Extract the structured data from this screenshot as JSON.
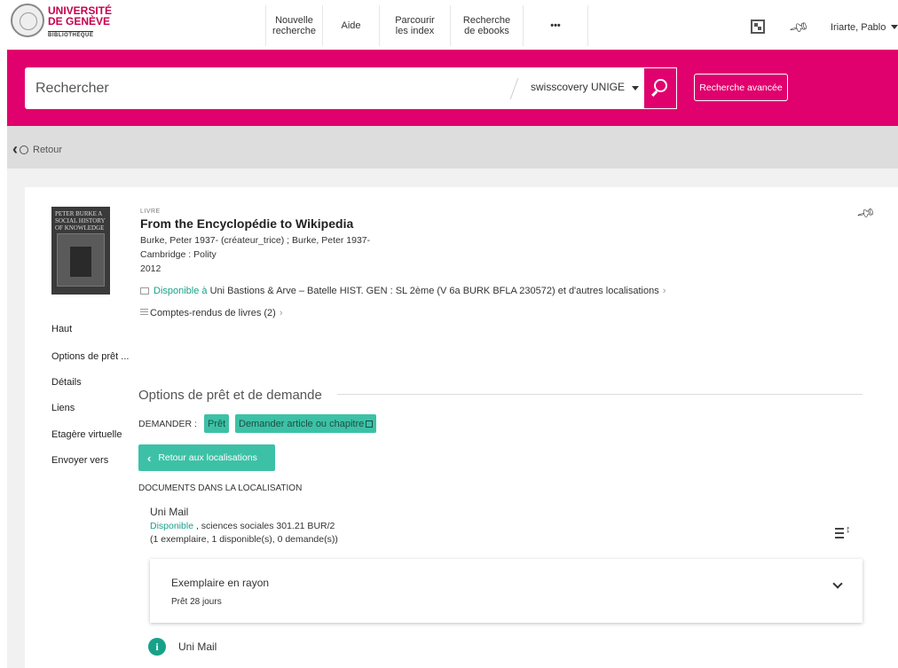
{
  "header": {
    "logo_line1": "UNIVERSITÉ",
    "logo_line2": "DE GENÈVE",
    "logo_sub": "BIBLIOTHÈQUE",
    "nav": [
      {
        "line1": "Nouvelle",
        "line2": "recherche"
      },
      {
        "line1": "Aide",
        "line2": ""
      },
      {
        "line1": "Parcourir",
        "line2": "les index"
      },
      {
        "line1": "Recherche",
        "line2": "de ebooks"
      },
      {
        "line1": "•••",
        "line2": ""
      }
    ],
    "user": "Iriarte, Pablo"
  },
  "search": {
    "placeholder": "Rechercher",
    "scope": "swisscovery UNIGE",
    "advanced_label": "Recherche avancée"
  },
  "backbar": {
    "back_label": "Retour"
  },
  "record": {
    "type": "LIVRE",
    "title": "From the Encyclopédie to Wikipedia",
    "creators": "Burke, Peter 1937- (créateur_trice) ; Burke, Peter 1937-",
    "publisher": "Cambridge : Polity",
    "year": "2012",
    "availability_prefix": "Disponible à",
    "availability_rest": " Uni Bastions & Arve – Batelle  HIST. GEN : SL 2ème (V 6a BURK BFLA 230572) et d'autres localisations",
    "reviews": "Comptes-rendus de livres (2)",
    "cover_text": "PETER BURKE A SOCIAL HISTORY OF KNOWLEDGE"
  },
  "sidenav": [
    "Haut",
    "Options de prêt ...",
    "Détails",
    "Liens",
    "Etagère virtuelle",
    "Envoyer vers"
  ],
  "loan": {
    "section_title": "Options de prêt et de demande",
    "demander_label": "DEMANDER :",
    "chip_pret": "Prêt",
    "chip_article": "Demander article ou chapitre",
    "retour_localisations": "Retour aux localisations",
    "docs_heading": "DOCUMENTS DANS LA LOCALISATION",
    "location_name": "Uni Mail",
    "location_status": "Disponible",
    "location_callno": " , sciences sociales 301.21 BUR/2",
    "location_counts": "(1 exemplaire, 1 disponible(s), 0 demande(s))",
    "item_title": "Exemplaire en rayon",
    "item_policy": "Prêt 28 jours",
    "info_label": "Uni Mail"
  },
  "colors": {
    "brand": "#e0006e",
    "accent": "#3dc1a6",
    "available": "#18a189"
  }
}
